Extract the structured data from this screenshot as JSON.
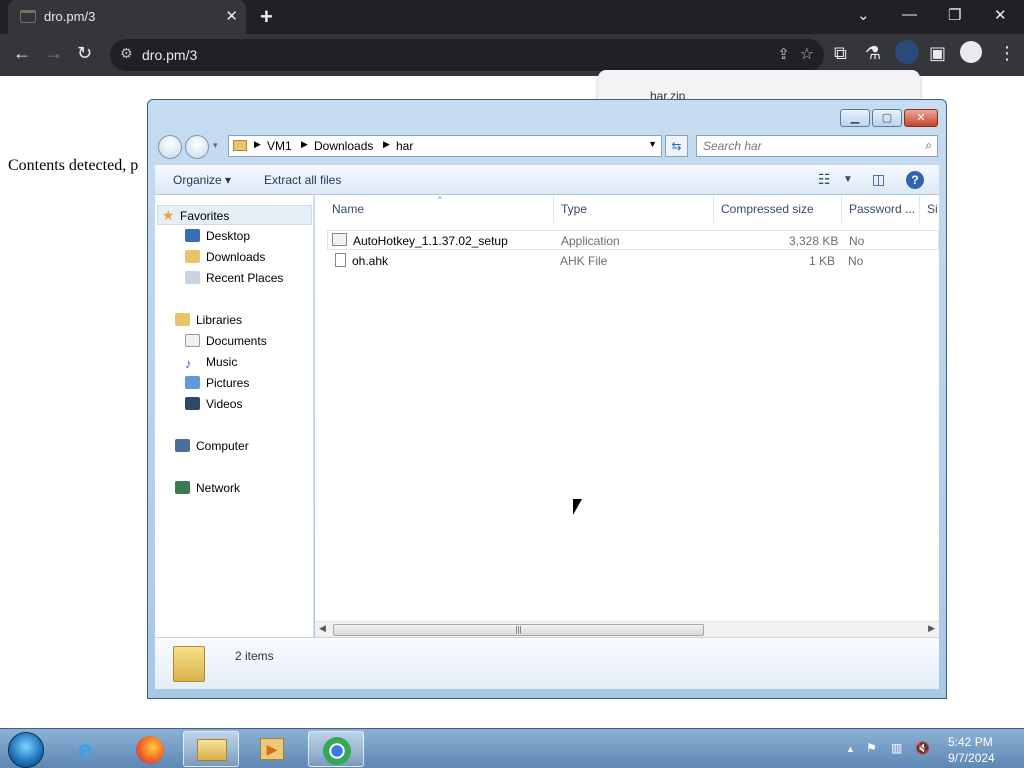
{
  "browser": {
    "tab_title": "dro.pm/3",
    "url": "dro.pm/3",
    "tab_close": "✕",
    "new_tab": "+",
    "download_popup_name": "har.zip"
  },
  "page": {
    "text": "Contents detected, p"
  },
  "explorer": {
    "breadcrumbs": [
      "VM1",
      "Downloads",
      "har"
    ],
    "search_placeholder": "Search har",
    "commands": {
      "organize": "Organize ▾",
      "extract_all": "Extract all files"
    },
    "nav": {
      "favorites": "Favorites",
      "desktop": "Desktop",
      "downloads": "Downloads",
      "recent_places": "Recent Places",
      "libraries": "Libraries",
      "documents": "Documents",
      "music": "Music",
      "pictures": "Pictures",
      "videos": "Videos",
      "computer": "Computer",
      "network": "Network"
    },
    "columns": {
      "name": "Name",
      "type": "Type",
      "compressed_size": "Compressed size",
      "password": "Password ...",
      "size": "Si"
    },
    "files": [
      {
        "name": "AutoHotkey_1.1.37.02_setup",
        "type": "Application",
        "size": "3,328 KB",
        "password": "No"
      },
      {
        "name": "oh.ahk",
        "type": "AHK File",
        "size": "1 KB",
        "password": "No"
      }
    ],
    "item_count": "2 items",
    "scroll_grip": "|||"
  },
  "taskbar": {
    "time": "5:42 PM",
    "date": "9/7/2024"
  },
  "colors": {
    "chrome_dark": "#202124",
    "chrome_toolbar": "#35363a",
    "aero_frame": "#c6dcf0",
    "taskbar": "#6e96c1"
  }
}
